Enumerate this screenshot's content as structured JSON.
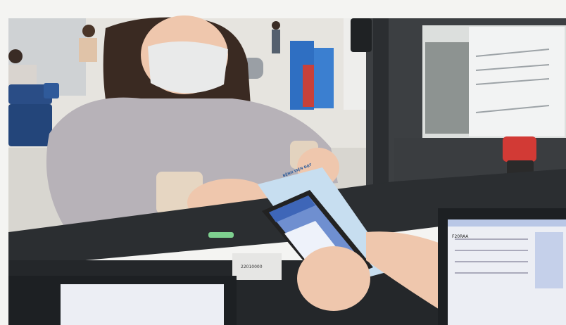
{
  "labels": {
    "paper_heading": "BỆNH VIỆN ĐẠT",
    "counter_sticker": "22010000",
    "monitor_tag": "F20RAA"
  },
  "colors": {
    "wall": "#f3f3f1",
    "counter_dark": "#2b2e31",
    "jacket": "#b7b2b8",
    "skin": "#efc7ad",
    "hair": "#3a2a22",
    "mask": "#e9eaea",
    "phone_screen": "#6f8fd0",
    "paper": "#c7def0",
    "stamp": "#d23a35",
    "chair_blue": "#2a4d86",
    "crate_blue": "#2f6fc2",
    "crate_red": "#c8413b",
    "monitor_screen": "#eceef4"
  }
}
